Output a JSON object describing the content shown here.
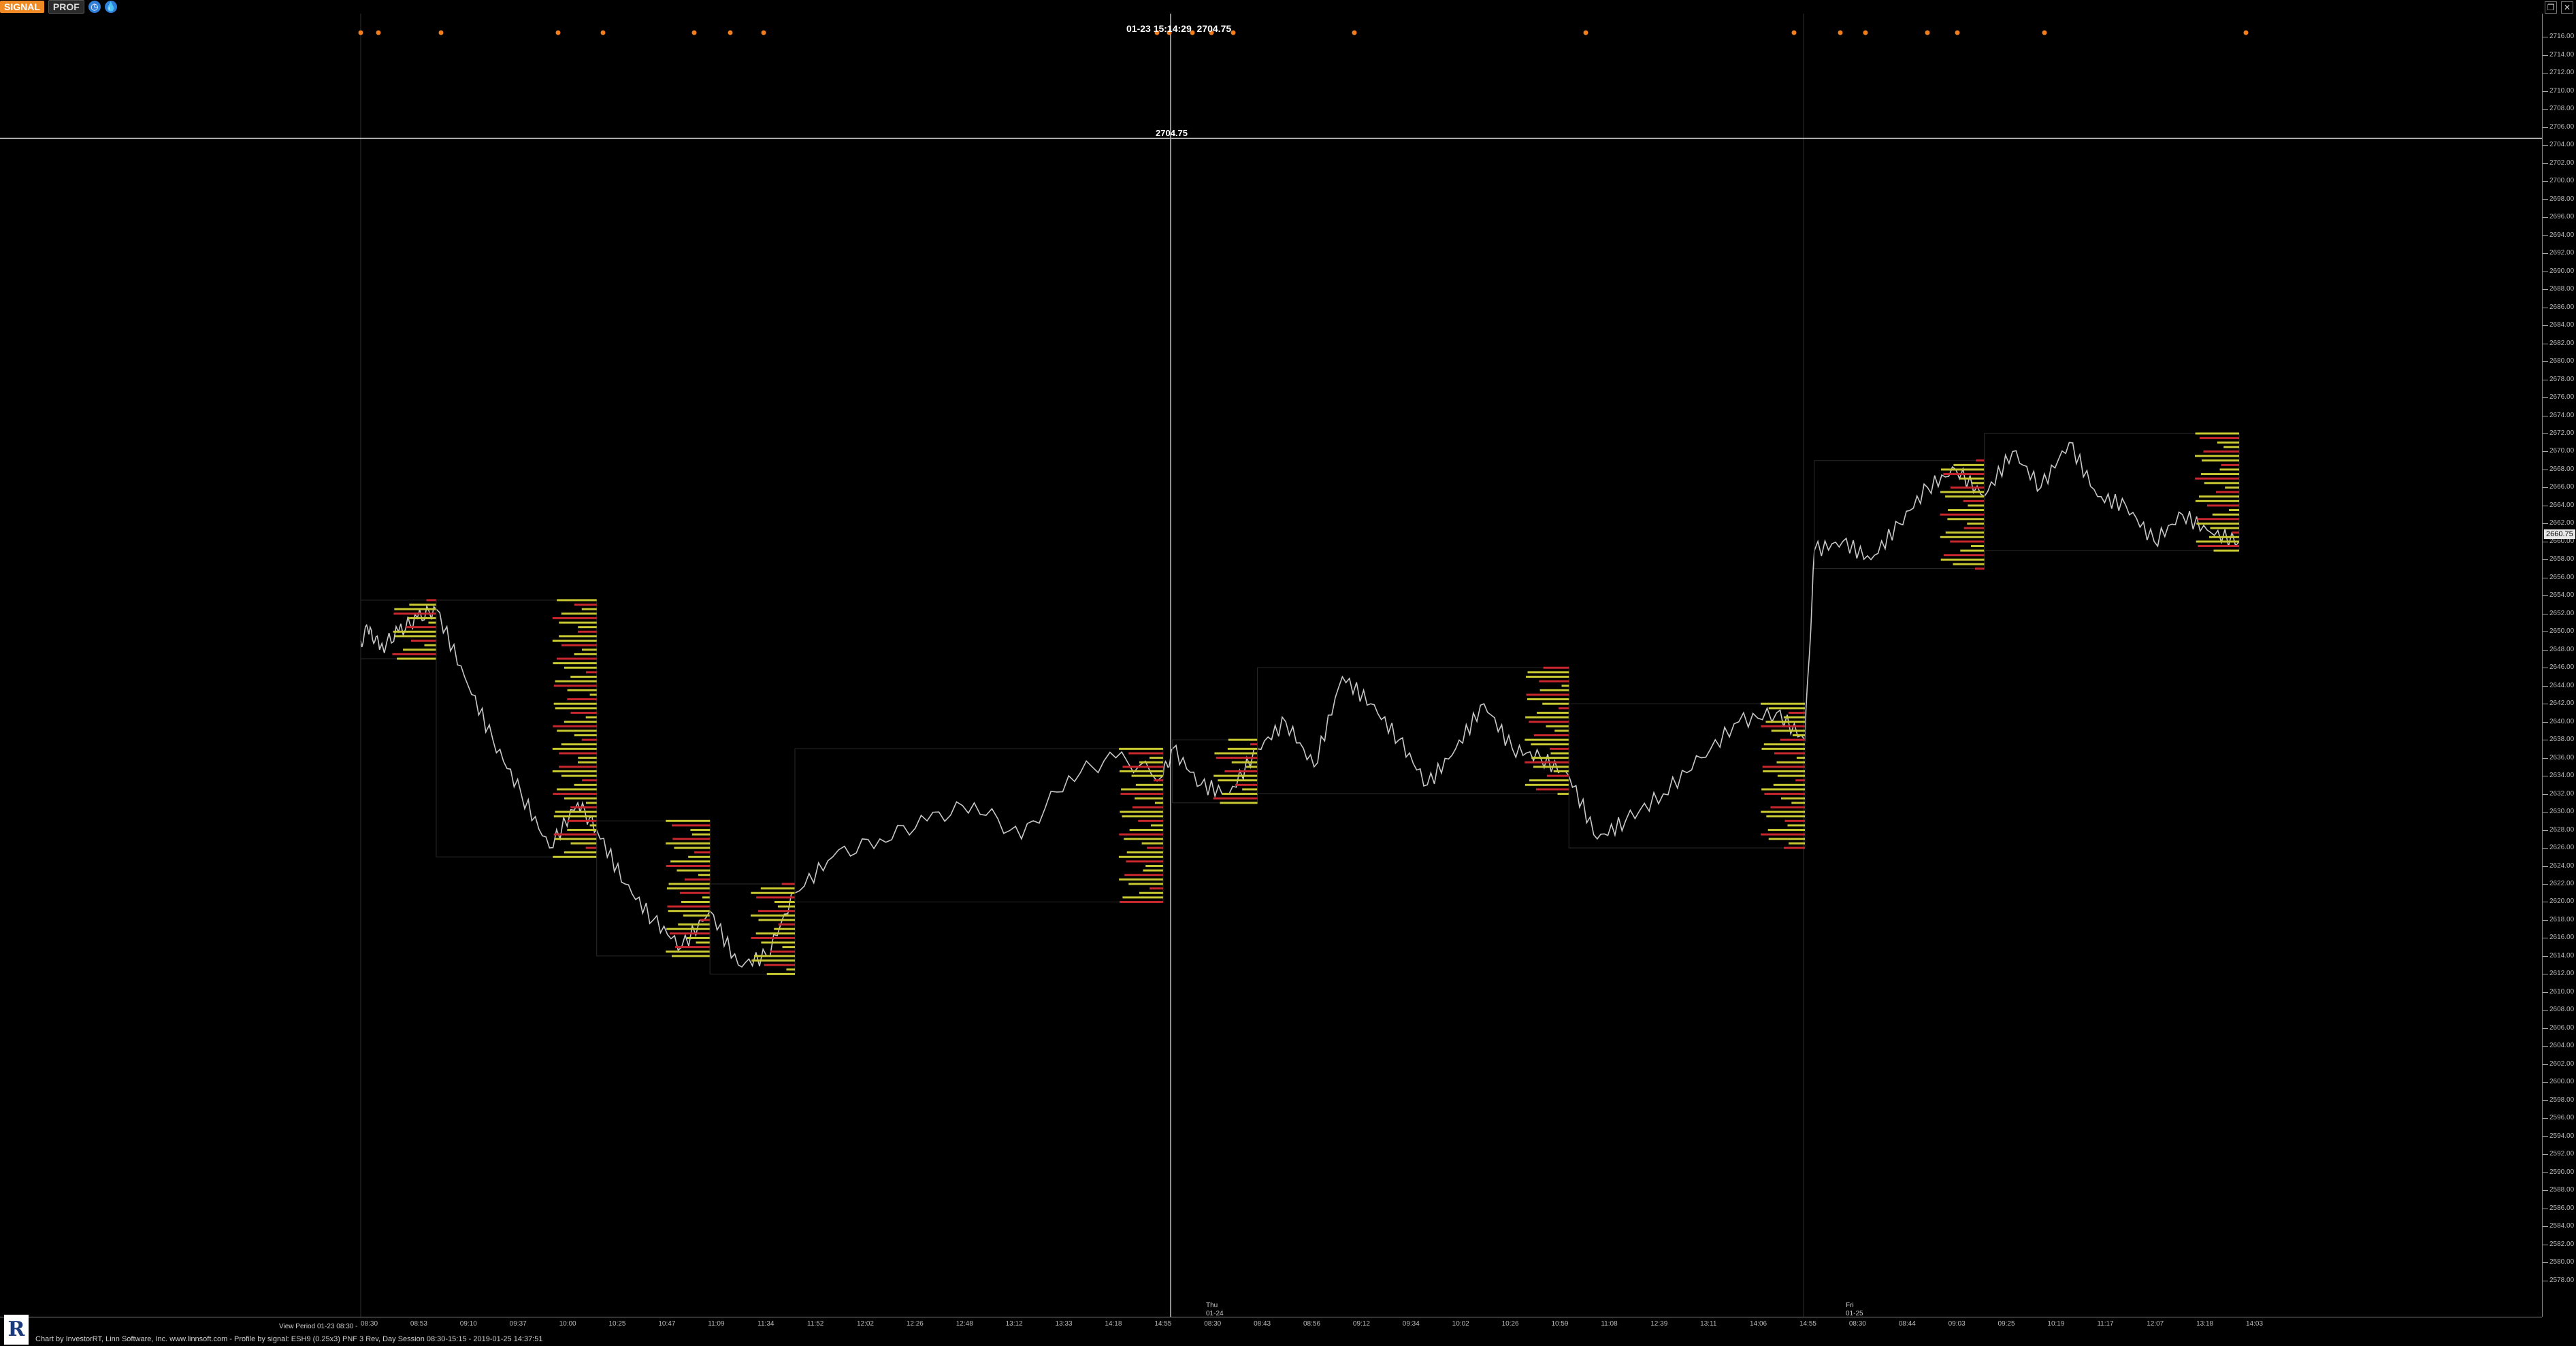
{
  "toolbar": {
    "signal_label": "SIGNAL",
    "prof_label": "PROF",
    "icons": [
      "clock-icon",
      "drop-icon"
    ]
  },
  "window_controls": [
    "restore-icon",
    "close-icon"
  ],
  "chart": {
    "crosshair_time": "01-23 15:14:29",
    "crosshair_price": "2704.75",
    "hline_price_label": "2704.75",
    "last_price": "2660.75",
    "view_period": "View Period 01-23 08:30 -",
    "footer": "Chart by InvestorRT, Linn Software, Inc. www.linnsoft.com - Profile by signal: ESH9 (0.25x3) PNF 3 Rev, Day Session 08:30-15:15 - 2019-01-25 14:37:51",
    "day_labels": [
      {
        "name": "Thu",
        "date": "01-24"
      },
      {
        "name": "Fri",
        "date": "01-25"
      }
    ],
    "colors": {
      "price_line": "#c8c8c8",
      "volume_up": "#c8c832",
      "volume_down": "#c8282d",
      "signal_dot": "#f07d1e",
      "grid": "#2a2a2a"
    }
  },
  "chart_data": {
    "type": "line",
    "y_axis_labels": [
      "2716.00",
      "2714.00",
      "2712.00",
      "2710.00",
      "2708.00",
      "2706.00",
      "2704.00",
      "2702.00",
      "2700.00",
      "2698.00",
      "2696.00",
      "2694.00",
      "2692.00",
      "2690.00",
      "2688.00",
      "2686.00",
      "2684.00",
      "2682.00",
      "2680.00",
      "2678.00",
      "2676.00",
      "2674.00",
      "2672.00",
      "2670.00",
      "2668.00",
      "2666.00",
      "2664.00",
      "2662.00",
      "2660.00",
      "2658.00",
      "2656.00",
      "2654.00",
      "2652.00",
      "2650.00",
      "2648.00",
      "2646.00",
      "2644.00",
      "2642.00",
      "2640.00",
      "2638.00",
      "2636.00",
      "2634.00",
      "2632.00",
      "2630.00",
      "2628.00",
      "2626.00",
      "2624.00",
      "2622.00",
      "2620.00",
      "2618.00",
      "2616.00",
      "2614.00",
      "2612.00",
      "2610.00",
      "2608.00",
      "2606.00",
      "2604.00",
      "2602.00",
      "2600.00",
      "2598.00",
      "2596.00",
      "2594.00",
      "2592.00",
      "2590.00",
      "2588.00",
      "2586.00",
      "2584.00",
      "2582.00",
      "2580.00",
      "2578.00"
    ],
    "ylim": [
      2576,
      2718
    ],
    "x_axis_labels": [
      "08:30",
      "08:53",
      "09:10",
      "09:37",
      "10:00",
      "10:25",
      "10:47",
      "11:09",
      "11:34",
      "11:52",
      "12:02",
      "12:26",
      "12:48",
      "13:12",
      "13:33",
      "14:18",
      "14:55",
      "08:30",
      "08:43",
      "08:56",
      "09:12",
      "09:34",
      "10:02",
      "10:26",
      "10:59",
      "11:08",
      "12:39",
      "13:11",
      "14:06",
      "14:55",
      "08:30",
      "08:44",
      "09:03",
      "09:25",
      "10:19",
      "11:17",
      "12:07",
      "13:18",
      "14:03"
    ],
    "signal_dots_at_top": 22,
    "price_path": [
      {
        "t": 0,
        "p": 2649
      },
      {
        "t": 2,
        "p": 2650.5
      },
      {
        "t": 4,
        "p": 2648
      },
      {
        "t": 8,
        "p": 2650
      },
      {
        "t": 12,
        "p": 2651.5
      },
      {
        "t": 16,
        "p": 2652.5
      },
      {
        "t": 22,
        "p": 2645
      },
      {
        "t": 28,
        "p": 2638
      },
      {
        "t": 34,
        "p": 2632
      },
      {
        "t": 40,
        "p": 2626
      },
      {
        "t": 46,
        "p": 2631
      },
      {
        "t": 50,
        "p": 2628
      },
      {
        "t": 56,
        "p": 2622
      },
      {
        "t": 62,
        "p": 2618
      },
      {
        "t": 68,
        "p": 2615
      },
      {
        "t": 74,
        "p": 2619
      },
      {
        "t": 80,
        "p": 2613
      },
      {
        "t": 86,
        "p": 2614
      },
      {
        "t": 92,
        "p": 2621
      },
      {
        "t": 100,
        "p": 2625
      },
      {
        "t": 110,
        "p": 2627
      },
      {
        "t": 120,
        "p": 2629
      },
      {
        "t": 130,
        "p": 2631
      },
      {
        "t": 140,
        "p": 2627
      },
      {
        "t": 150,
        "p": 2634
      },
      {
        "t": 160,
        "p": 2636
      },
      {
        "t": 170,
        "p": 2634
      },
      {
        "t": 172,
        "p": 2637
      },
      {
        "t": 178,
        "p": 2633
      },
      {
        "t": 184,
        "p": 2632
      },
      {
        "t": 190,
        "p": 2637
      },
      {
        "t": 196,
        "p": 2640
      },
      {
        "t": 202,
        "p": 2635
      },
      {
        "t": 208,
        "p": 2645
      },
      {
        "t": 214,
        "p": 2642
      },
      {
        "t": 220,
        "p": 2638
      },
      {
        "t": 226,
        "p": 2633
      },
      {
        "t": 232,
        "p": 2637
      },
      {
        "t": 238,
        "p": 2642
      },
      {
        "t": 244,
        "p": 2637
      },
      {
        "t": 250,
        "p": 2636
      },
      {
        "t": 256,
        "p": 2634
      },
      {
        "t": 262,
        "p": 2627
      },
      {
        "t": 268,
        "p": 2629
      },
      {
        "t": 276,
        "p": 2632
      },
      {
        "t": 284,
        "p": 2636
      },
      {
        "t": 292,
        "p": 2640
      },
      {
        "t": 300,
        "p": 2641
      },
      {
        "t": 306,
        "p": 2638
      },
      {
        "t": 308,
        "p": 2659
      },
      {
        "t": 314,
        "p": 2660
      },
      {
        "t": 320,
        "p": 2658
      },
      {
        "t": 326,
        "p": 2662
      },
      {
        "t": 332,
        "p": 2666
      },
      {
        "t": 338,
        "p": 2668
      },
      {
        "t": 344,
        "p": 2665
      },
      {
        "t": 350,
        "p": 2670
      },
      {
        "t": 356,
        "p": 2666
      },
      {
        "t": 362,
        "p": 2671
      },
      {
        "t": 368,
        "p": 2665
      },
      {
        "t": 374,
        "p": 2664
      },
      {
        "t": 380,
        "p": 2660
      },
      {
        "t": 386,
        "p": 2663
      },
      {
        "t": 392,
        "p": 2661
      },
      {
        "t": 398,
        "p": 2660
      }
    ]
  }
}
